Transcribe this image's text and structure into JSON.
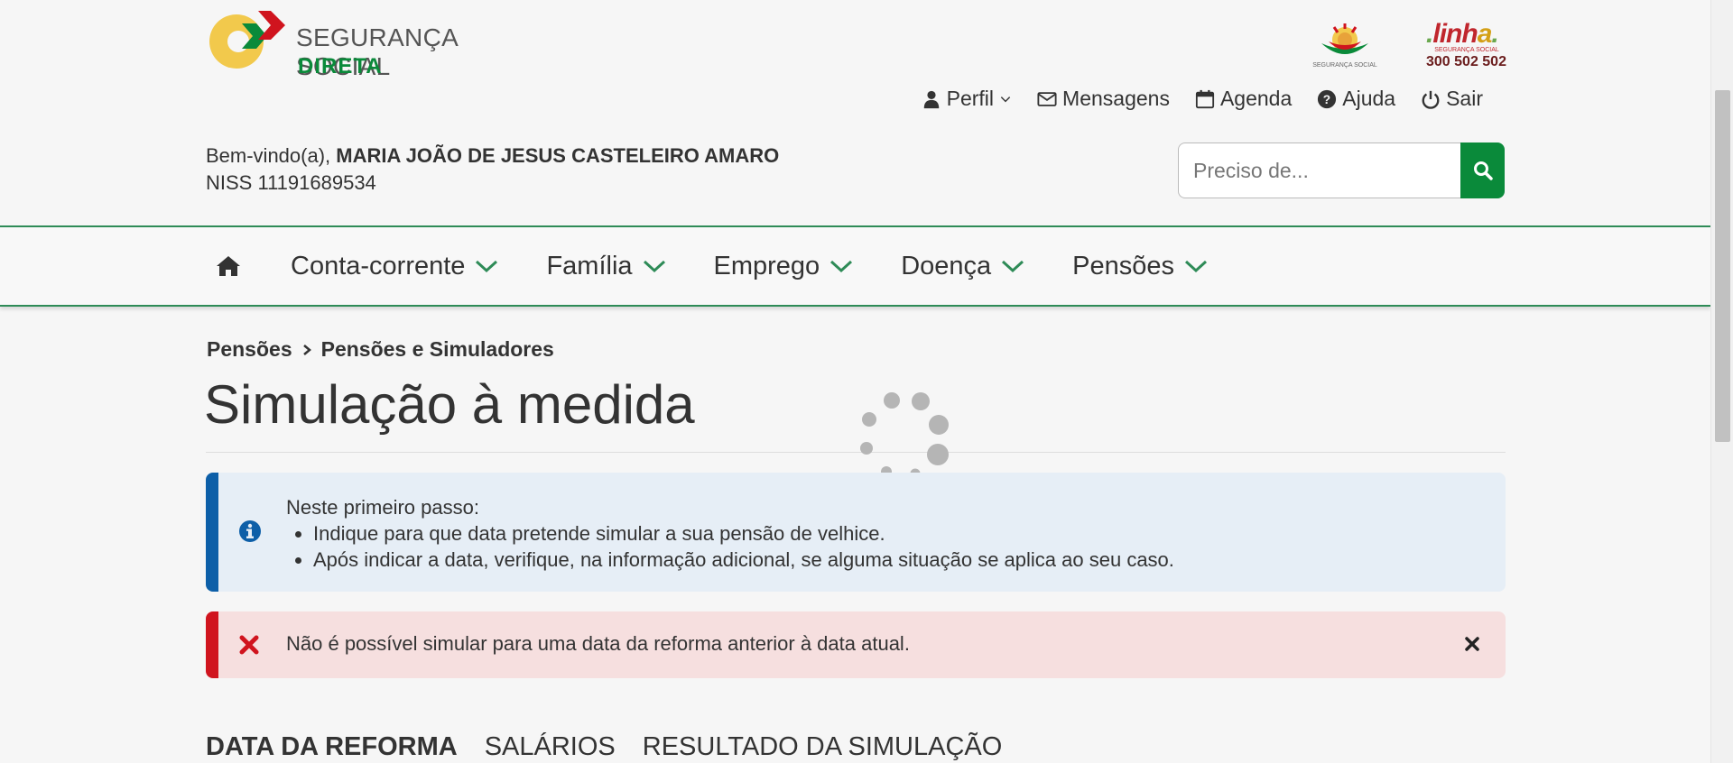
{
  "header": {
    "logo_line1": "SEGURANÇA SOCIAL",
    "logo_line2": "DIRETA",
    "ss_logo_caption": "SEGURANÇA SOCIAL",
    "linha_word_parts": [
      ".",
      "l",
      "inh",
      "a",
      "."
    ],
    "linha_caption": "SEGURANÇA SOCIAL",
    "linha_number": "300 502 502"
  },
  "topnav": {
    "profile": "Perfil",
    "messages": "Mensagens",
    "agenda": "Agenda",
    "help": "Ajuda",
    "logout": "Sair"
  },
  "welcome": {
    "greeting": "Bem-vindo(a),",
    "name": "MARIA JOÃO DE JESUS CASTELEIRO AMARO",
    "niss": "NISS 11191689534"
  },
  "search": {
    "placeholder": "Preciso de..."
  },
  "mainnav": {
    "items": [
      "Conta-corrente",
      "Família",
      "Emprego",
      "Doença",
      "Pensões"
    ]
  },
  "breadcrumb": {
    "items": [
      "Pensões",
      "Pensões e Simuladores"
    ]
  },
  "page": {
    "title": "Simulação à medida"
  },
  "info_alert": {
    "heading": "Neste primeiro passo:",
    "items": [
      "Indique para que data pretende simular a sua pensão de velhice.",
      "Após indicar a data, verifique, na informação adicional, se alguma situação se aplica ao seu caso."
    ]
  },
  "error_alert": {
    "message": "Não é possível simular para uma data da reforma anterior à data atual."
  },
  "tabs": {
    "items": [
      "DATA DA REFORMA",
      "SALÁRIOS",
      "RESULTADO DA SIMULAÇÃO"
    ]
  },
  "colors": {
    "brand_green": "#0a8a3a",
    "info_blue": "#0d5fa8",
    "error_red": "#d0141e"
  }
}
